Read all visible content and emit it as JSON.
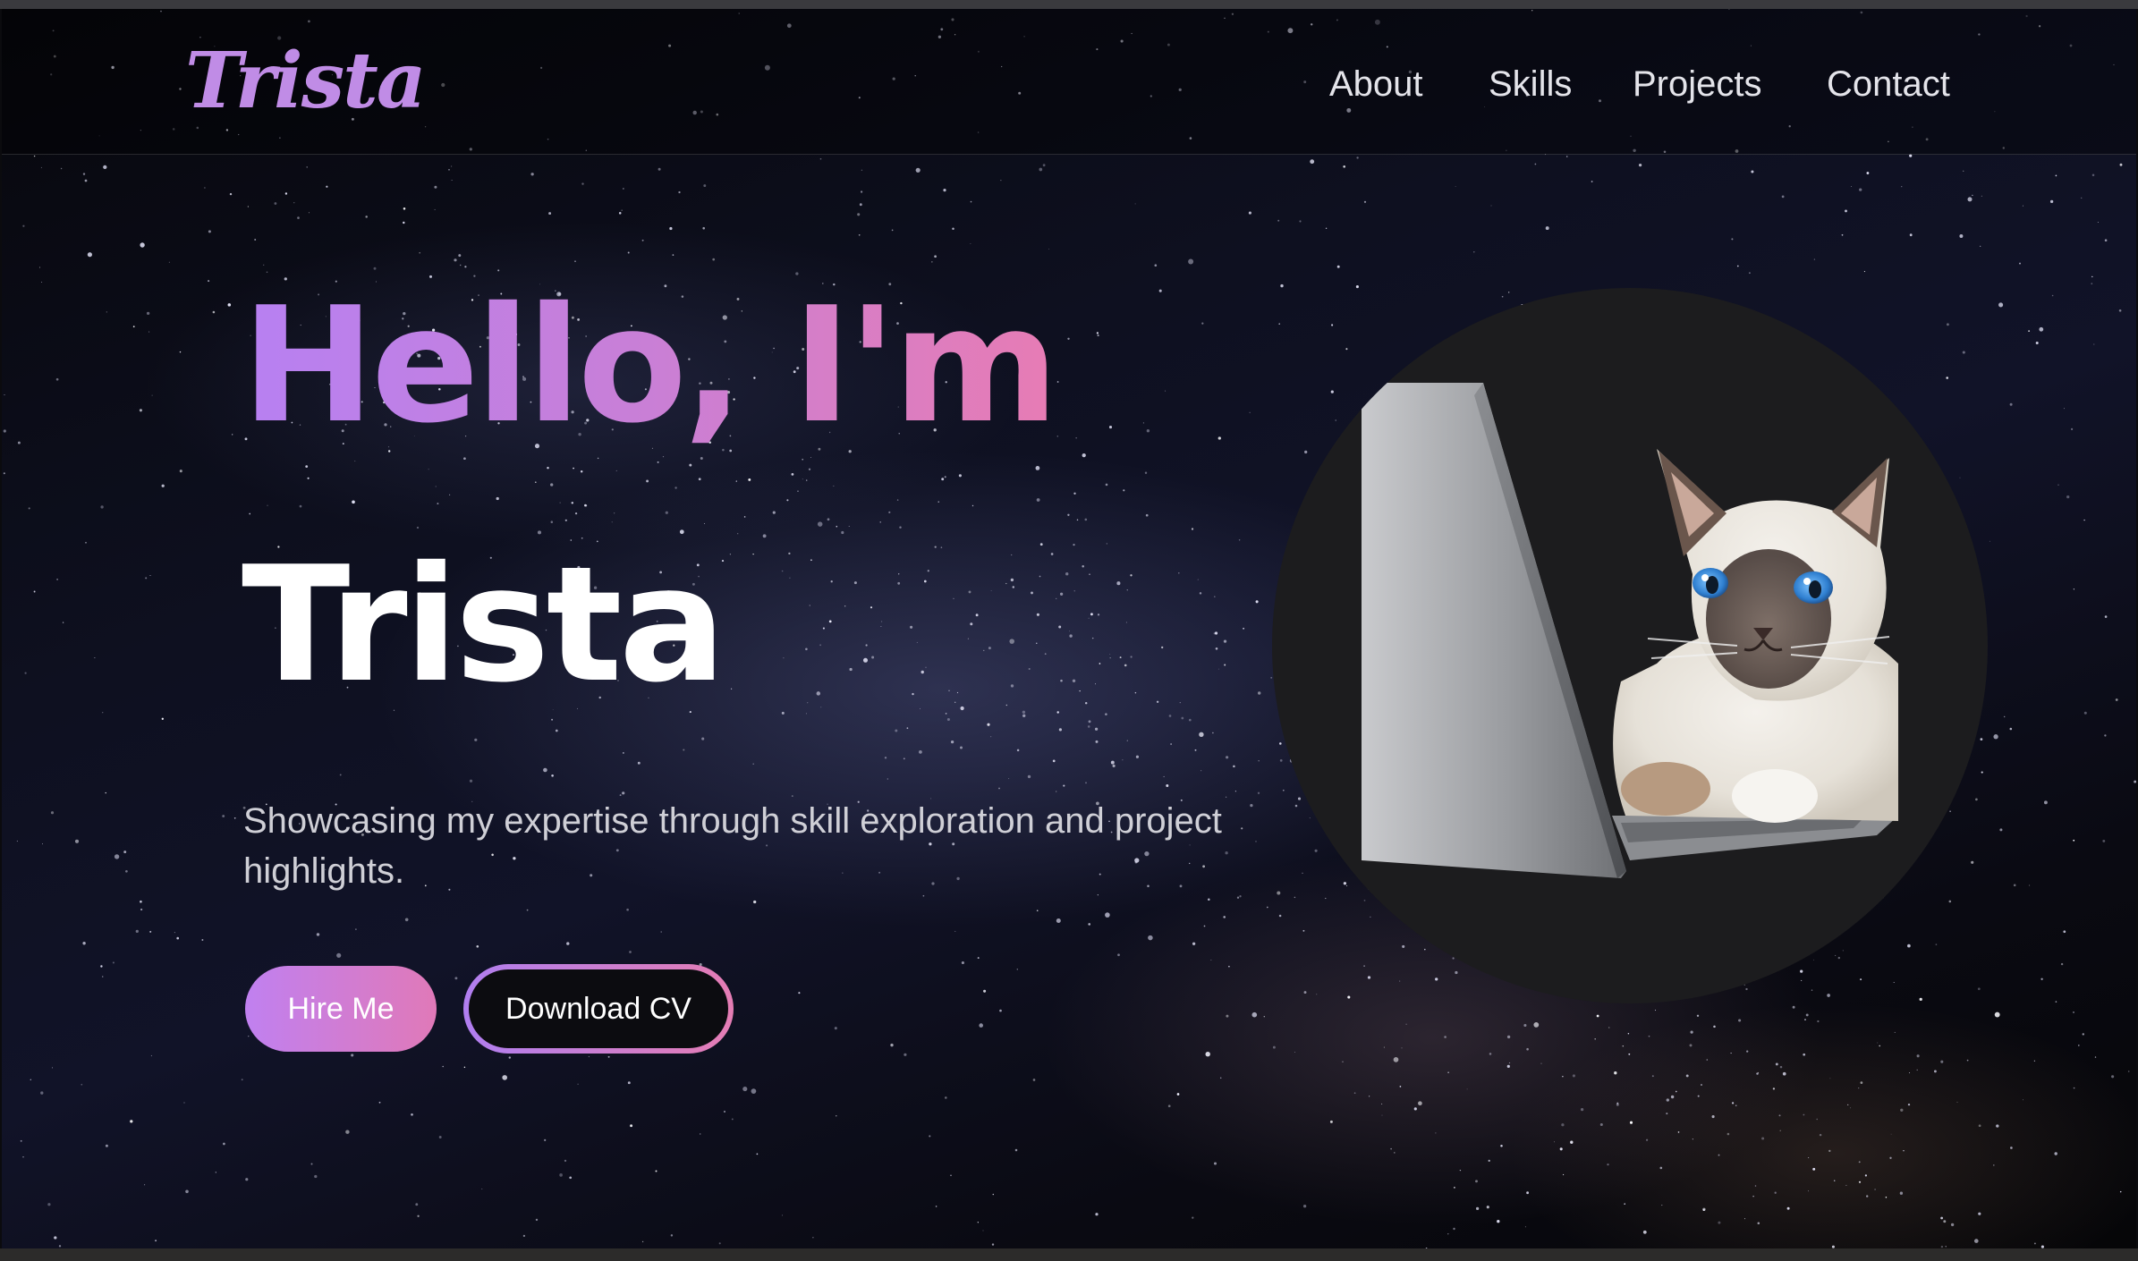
{
  "header": {
    "logo": "Trista",
    "nav": [
      "About",
      "Skills",
      "Projects",
      "Contact"
    ]
  },
  "hero": {
    "greeting": "Hello, I'm",
    "name": "Trista",
    "description": "Showcasing my expertise through skill exploration and project highlights.",
    "primary_button": "Hire Me",
    "secondary_button": "Download CV"
  },
  "avatar": {
    "icon": "cat-with-laptop-image"
  },
  "colors": {
    "accent_purple": "#b780f2",
    "accent_pink": "#e77cb4",
    "background": "#0b0b0e"
  }
}
